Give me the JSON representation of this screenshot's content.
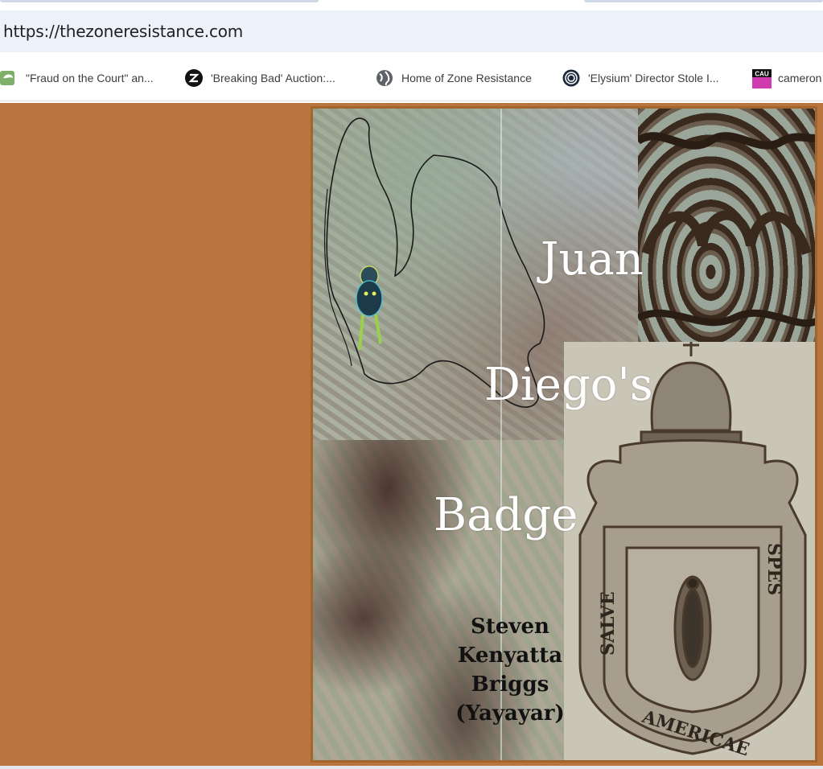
{
  "browser": {
    "url": "https://thezoneresistance.com",
    "bookmarks": [
      {
        "label": "\"Fraud on the Court\" an...",
        "icon": "green-leaf-icon"
      },
      {
        "label": "'Breaking Bad' Auction:...",
        "icon": "z-logo-icon"
      },
      {
        "label": "Home of Zone Resistance",
        "icon": "globe-icon"
      },
      {
        "label": "'Elysium' Director Stole I...",
        "icon": "spiral-logo-icon"
      },
      {
        "label": "cameron",
        "icon": "cau-logo-icon"
      }
    ]
  },
  "page": {
    "background_color": "#b8763e",
    "title_words": [
      "Juan",
      "Diego's",
      "Badge"
    ],
    "author_lines": [
      "Steven",
      "Kenyatta",
      "Briggs",
      "(Yayayar)"
    ]
  }
}
